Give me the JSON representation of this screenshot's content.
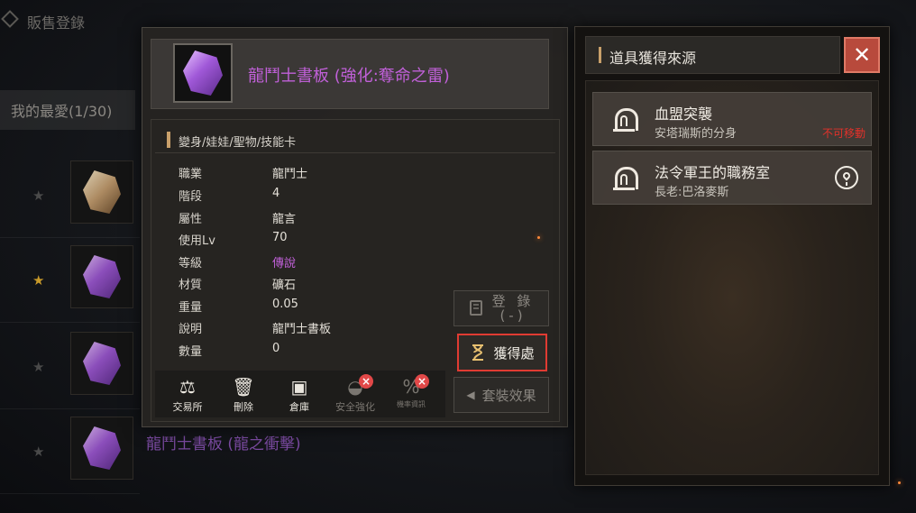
{
  "background": {
    "header_title": "販售登錄",
    "favorites_tab": "我的最愛(1/30)",
    "rows": [
      {
        "star": "gold_faded"
      },
      {
        "star": "gold"
      },
      {
        "star": "none"
      },
      {
        "star": "none"
      }
    ],
    "partial_item_name": "龍鬥士書板 (龍之衝擊)"
  },
  "item": {
    "name": "龍鬥士書板 (強化:奪命之雷)",
    "category": "變身/娃娃/聖物/技能卡",
    "stats": [
      {
        "label": "職業",
        "value": "龍鬥士"
      },
      {
        "label": "階段",
        "value": "4"
      },
      {
        "label": "屬性",
        "value": "龍言"
      },
      {
        "label": "使用Lv",
        "value": "70"
      },
      {
        "label": "等級",
        "value": "傳說",
        "color": "#c060d8"
      },
      {
        "label": "材質",
        "value": "礦石"
      },
      {
        "label": "重量",
        "value": "0.05"
      },
      {
        "label": "說明",
        "value": "龍鬥士書板"
      },
      {
        "label": "數量",
        "value": "0"
      }
    ],
    "actions": {
      "register_label": "登 錄",
      "register_sub": "(-)",
      "obtain_label": "獲得處",
      "set_effect_label": "套裝效果"
    },
    "toolbar": [
      {
        "label": "交易所",
        "icon": "scale-icon",
        "enabled": true
      },
      {
        "label": "刪除",
        "icon": "trash-icon",
        "enabled": true
      },
      {
        "label": "倉庫",
        "icon": "chest-icon",
        "enabled": true
      },
      {
        "label": "安全強化",
        "icon": "shield-enhance-icon",
        "enabled": false
      },
      {
        "label": "機率資訊",
        "icon": "probability-icon",
        "enabled": false
      }
    ]
  },
  "source_panel": {
    "title": "道具獲得來源",
    "close_icon": "close-icon",
    "entries": [
      {
        "name": "血盟突襲",
        "sub": "安塔瑞斯的分身",
        "status": "不可移動",
        "status_color": "#e2312a",
        "icon": "dungeon-gate-icon"
      },
      {
        "name": "法令軍王的職務室",
        "sub": "長老:巴洛麥斯",
        "status": "",
        "icon": "dungeon-gate-icon",
        "action_icon": "location-pin-icon"
      }
    ]
  },
  "colors": {
    "legendary": "#c060d8",
    "accent_gold": "#c9a06a",
    "alert_red": "#e2312a",
    "highlight_border": "#e03b32"
  }
}
